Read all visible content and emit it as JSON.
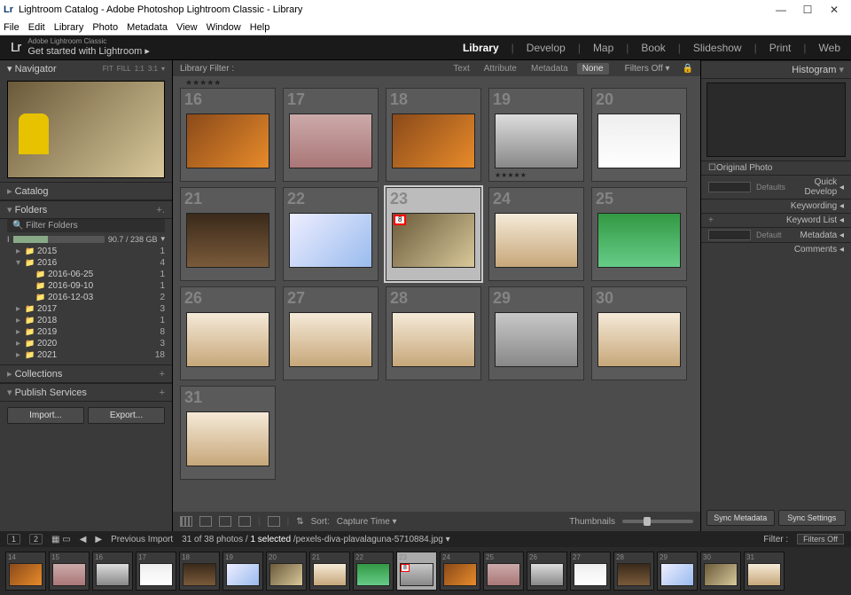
{
  "window": {
    "icon": "Lr",
    "title": "Lightroom Catalog - Adobe Photoshop Lightroom Classic - Library"
  },
  "menubar": [
    "File",
    "Edit",
    "Library",
    "Photo",
    "Metadata",
    "View",
    "Window",
    "Help"
  ],
  "brand": {
    "logo": "Lr",
    "small": "Adobe Lightroom Classic",
    "getstarted": "Get started with Lightroom ▸"
  },
  "modules": {
    "library": "Library",
    "develop": "Develop",
    "map": "Map",
    "book": "Book",
    "slideshow": "Slideshow",
    "print": "Print",
    "web": "Web"
  },
  "left": {
    "navigator": {
      "label": "Navigator",
      "modes": [
        "FIT",
        "FILL",
        "1:1",
        "3:1"
      ]
    },
    "catalog": "Catalog",
    "folders": {
      "label": "Folders",
      "filter": "Filter Folders",
      "volume_label": "I",
      "volume_size": "90.7 / 238 GB"
    },
    "tree": [
      {
        "lvl": 1,
        "open": "▸",
        "icon": "📁",
        "name": "2015",
        "count": "1"
      },
      {
        "lvl": 1,
        "open": "▾",
        "icon": "📁",
        "name": "2016",
        "count": "4"
      },
      {
        "lvl": 2,
        "open": "",
        "icon": "📁",
        "name": "2016-06-25",
        "count": "1"
      },
      {
        "lvl": 2,
        "open": "",
        "icon": "📁",
        "name": "2016-09-10",
        "count": "1"
      },
      {
        "lvl": 2,
        "open": "",
        "icon": "📁",
        "name": "2016-12-03",
        "count": "2"
      },
      {
        "lvl": 1,
        "open": "▸",
        "icon": "📁",
        "name": "2017",
        "count": "3"
      },
      {
        "lvl": 1,
        "open": "▸",
        "icon": "📁",
        "name": "2018",
        "count": "1"
      },
      {
        "lvl": 1,
        "open": "▸",
        "icon": "📁",
        "name": "2019",
        "count": "8"
      },
      {
        "lvl": 1,
        "open": "▸",
        "icon": "📁",
        "name": "2020",
        "count": "3"
      },
      {
        "lvl": 1,
        "open": "▸",
        "icon": "📁",
        "name": "2021",
        "count": "18"
      }
    ],
    "collections": "Collections",
    "publish": "Publish Services",
    "import": "Import...",
    "export": "Export..."
  },
  "center": {
    "filter": {
      "label": "Library Filter :",
      "chips": {
        "text": "Text",
        "attribute": "Attribute",
        "metadata": "Metadata",
        "none": "None"
      },
      "off": "Filters Off ▾"
    },
    "stars": "★★★★★",
    "rows": [
      {
        "nums": [
          "16",
          "17",
          "18",
          "19",
          "20"
        ],
        "pal": [
          "p1",
          "p2",
          "p1",
          "p4",
          "p5"
        ],
        "rated": 3
      },
      {
        "nums": [
          "21",
          "22",
          "23",
          "24",
          "25"
        ],
        "pal": [
          "p6",
          "p7",
          "p3",
          "p8",
          "p9"
        ],
        "sel": 2,
        "flag": 2
      },
      {
        "nums": [
          "26",
          "27",
          "28",
          "29",
          "30"
        ],
        "pal": [
          "p8",
          "p8",
          "p8",
          "p10",
          "p8"
        ]
      },
      {
        "nums": [
          "31"
        ],
        "pal": [
          "p8"
        ]
      }
    ],
    "flag_num": "8",
    "toolbar": {
      "sort_label": "Sort:",
      "sort_value": "Capture Time",
      "thumb_label": "Thumbnails"
    }
  },
  "right": {
    "histogram": "Histogram",
    "original": "Original Photo",
    "defaults": "Defaults",
    "default": "Default",
    "panels": {
      "quick": "Quick Develop",
      "keywording": "Keywording",
      "keyword_list": "Keyword List",
      "metadata": "Metadata",
      "comments": "Comments"
    },
    "sync_meta": "Sync Metadata",
    "sync_set": "Sync Settings"
  },
  "status": {
    "pages": [
      "1",
      "2"
    ],
    "prev": "Previous Import",
    "count": "31 of 38 photos /",
    "selected": "1 selected",
    "path": "/pexels-diva-plavalaguna-5710884.jpg",
    "filter_label": "Filter :",
    "filter_value": "Filters Off"
  },
  "film": {
    "start": 14,
    "count": 18,
    "sel": 23,
    "flag": 23
  }
}
